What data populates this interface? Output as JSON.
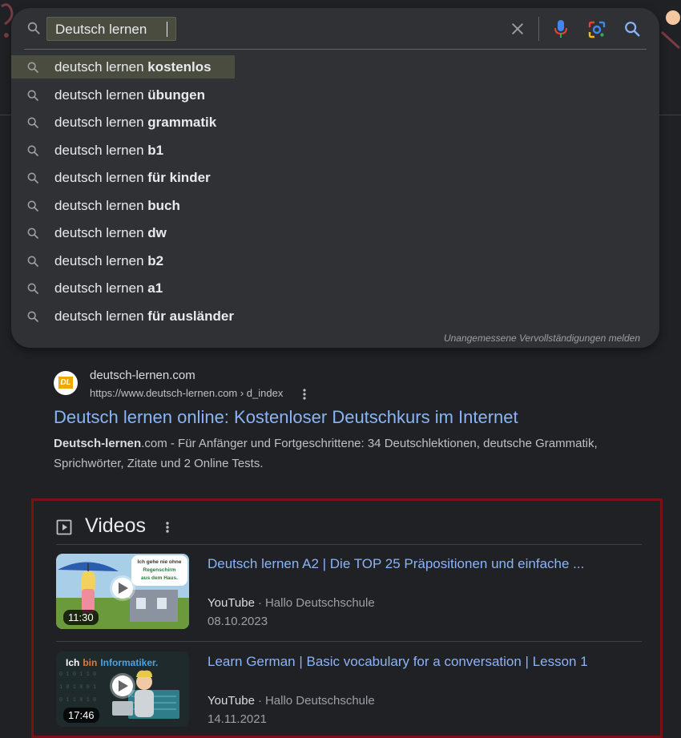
{
  "search": {
    "query": "Deutsch lernen",
    "suggestions": [
      {
        "prefix": "deutsch lernen ",
        "completion": "kostenlos"
      },
      {
        "prefix": "deutsch lernen ",
        "completion": "übungen"
      },
      {
        "prefix": "deutsch lernen ",
        "completion": "grammatik"
      },
      {
        "prefix": "deutsch lernen ",
        "completion": "b1"
      },
      {
        "prefix": "deutsch lernen ",
        "completion": "für kinder"
      },
      {
        "prefix": "deutsch lernen ",
        "completion": "buch"
      },
      {
        "prefix": "deutsch lernen ",
        "completion": "dw"
      },
      {
        "prefix": "deutsch lernen ",
        "completion": "b2"
      },
      {
        "prefix": "deutsch lernen ",
        "completion": "a1"
      },
      {
        "prefix": "deutsch lernen ",
        "completion": "für ausländer"
      }
    ],
    "report_label": "Unangemessene Vervollständigungen melden",
    "icons": [
      "search-icon",
      "clear-icon",
      "mic-icon",
      "lens-icon",
      "search-submit-icon"
    ]
  },
  "result": {
    "favicon_text": "DL",
    "site_name": "deutsch-lernen.com",
    "url": "https://www.deutsch-lernen.com › d_index",
    "title": "Deutsch lernen online: Kostenloser Deutschkurs im Internet",
    "snippet_bold_1": "Deutsch-lernen",
    "snippet_plain_1": ".com - Für Anfänger und Fortgeschrittene: 34 Deutschlektionen, deutsche Grammatik, Sprichwörter, Zitate und 2 Online Tests."
  },
  "videos": {
    "heading": "Videos",
    "items": [
      {
        "title": "Deutsch lernen A2 | Die TOP 25 Präpositionen und einfache ...",
        "source": "YouTube",
        "channel": "Hallo Deutschschule",
        "date": "08.10.2023",
        "duration": "11:30",
        "thumb_bubble_lines": [
          "Ich gehe nie ohne",
          "Regenschirm",
          "aus dem Haus."
        ]
      },
      {
        "title": "Learn German | Basic vocabulary for a conversation | Lesson 1",
        "source": "YouTube",
        "channel": "Hallo Deutschschule",
        "date": "14.11.2021",
        "duration": "17:46",
        "thumb_words": [
          "Ich",
          "bin",
          "Informatiker."
        ]
      }
    ]
  },
  "colors": {
    "background": "#202124",
    "panel": "#303134",
    "link": "#8ab4f8",
    "highlight": "#4a4c40",
    "video_box_border": "#7a1214"
  }
}
